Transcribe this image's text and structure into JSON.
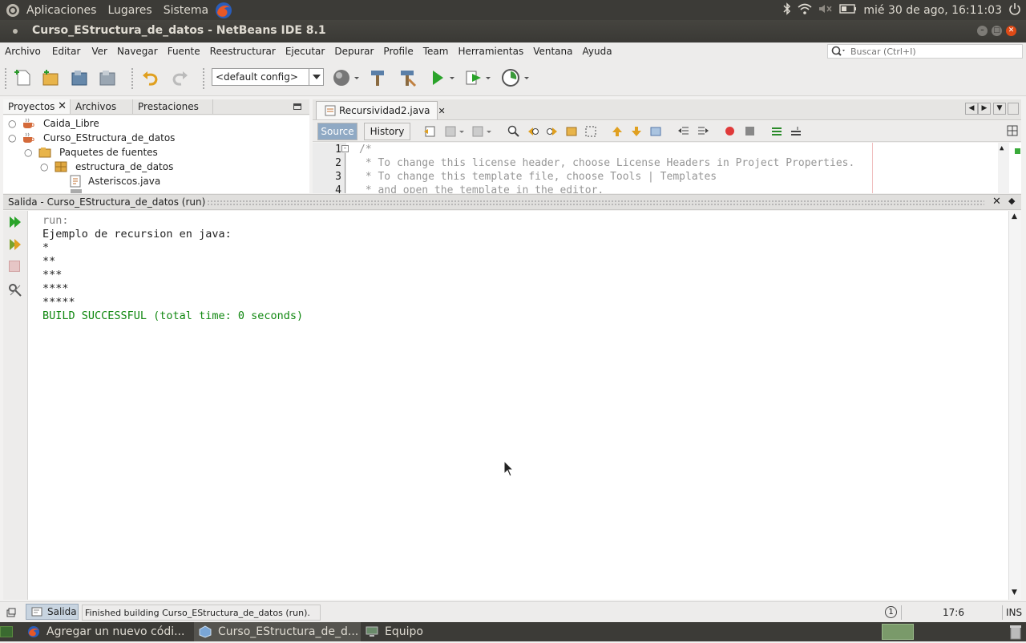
{
  "top_panel": {
    "menus": [
      "Aplicaciones",
      "Lugares",
      "Sistema"
    ],
    "clock": "mié 30 de ago, 16:11:03"
  },
  "window": {
    "title": "Curso_EStructura_de_datos - NetBeans IDE 8.1"
  },
  "menubar": {
    "items": [
      "Archivo",
      "Editar",
      "Ver",
      "Navegar",
      "Fuente",
      "Reestructurar",
      "Ejecutar",
      "Depurar",
      "Profile",
      "Team",
      "Herramientas",
      "Ventana",
      "Ayuda"
    ],
    "search_placeholder": "Buscar (Ctrl+I)"
  },
  "toolbar": {
    "config_value": "<default config>"
  },
  "projects_panel": {
    "tabs": [
      "Proyectos",
      "Archivos",
      "Prestaciones"
    ],
    "tree": [
      {
        "label": "Caida_Libre",
        "icon": "coffee-cup-project-icon"
      },
      {
        "label": "Curso_EStructura_de_datos",
        "icon": "coffee-cup-project-icon"
      },
      {
        "label": "Paquetes de fuentes",
        "icon": "source-packages-folder-icon"
      },
      {
        "label": "estructura_de_datos",
        "icon": "package-icon"
      },
      {
        "label": "Asteriscos.java",
        "icon": "java-file-icon"
      }
    ]
  },
  "editor": {
    "tab_label": "Recursividad2.java",
    "source_label": "Source",
    "history_label": "History",
    "line_numbers": [
      "1",
      "2",
      "3",
      "4"
    ],
    "lines": [
      "/*",
      " * To change this license header, choose License Headers in Project Properties.",
      " * To change this template file, choose Tools | Templates",
      " * and open the template in the editor."
    ]
  },
  "output": {
    "title": "Salida - Curso_EStructura_de_datos (run)",
    "lines": [
      {
        "text": "run:",
        "color": "#808080"
      },
      {
        "text": "Ejemplo de recursion en java:",
        "color": "#222222"
      },
      {
        "text": "*",
        "color": "#222222"
      },
      {
        "text": "**",
        "color": "#222222"
      },
      {
        "text": "***",
        "color": "#222222"
      },
      {
        "text": "****",
        "color": "#222222"
      },
      {
        "text": "*****",
        "color": "#222222"
      },
      {
        "text": "BUILD SUCCESSFUL (total time: 0 seconds)",
        "color": "#118811"
      }
    ]
  },
  "statusbar": {
    "salida_label": "Salida",
    "message": "Finished building Curso_EStructura_de_datos (run).",
    "notification_count": "1",
    "position": "17:6",
    "insert_mode": "INS"
  },
  "taskbar": {
    "items": [
      {
        "label": "Agregar un nuevo códi...",
        "icon": "firefox-icon"
      },
      {
        "label": "Curso_EStructura_de_d...",
        "icon": "netbeans-cube-icon"
      },
      {
        "label": "Equipo",
        "icon": "computer-icon"
      }
    ]
  },
  "colors": {
    "panel_bg": "#3c3b37",
    "accent_orange": "#e75827",
    "success_green": "#118811"
  }
}
